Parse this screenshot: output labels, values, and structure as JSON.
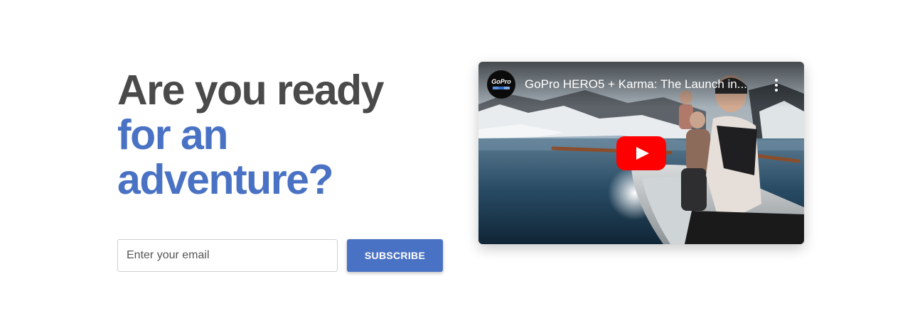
{
  "hero": {
    "line1": "Are you ready",
    "line2": "for an",
    "line3": "adventure?"
  },
  "signup": {
    "email_placeholder": "Enter your email",
    "email_value": "",
    "subscribe_label": "SUBSCRIBE"
  },
  "video": {
    "title": "GoPro HERO5 + Karma: The Launch in...",
    "channel_logo_text": "GoPro",
    "icons": {
      "avatar": "gopro-logo-icon",
      "menu": "more-vertical-icon",
      "play": "youtube-play-icon"
    }
  },
  "colors": {
    "heading_dark": "#4a4a4a",
    "accent_blue": "#4a72c4",
    "play_red": "#ff0000"
  }
}
